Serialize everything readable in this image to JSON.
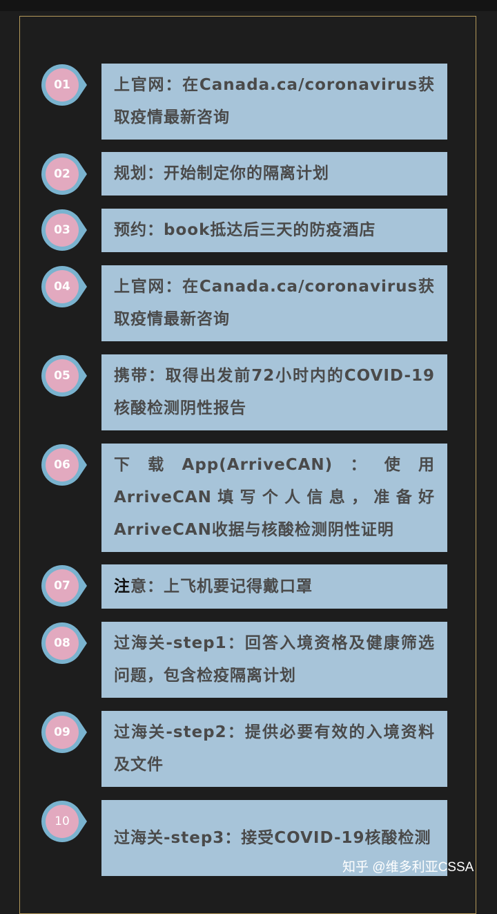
{
  "colors": {
    "background": "#1d1d1d",
    "frame_border": "#b59a5b",
    "box": "#a7c4d9",
    "badge_fill": "#e2a9bf",
    "badge_ring": "#7ab3cf",
    "text": "#4a4a4a"
  },
  "steps": [
    {
      "num": "01",
      "label": "上官网：",
      "text": "在Canada.ca/coronavirus获取疫情最新咨询"
    },
    {
      "num": "02",
      "label": "规划：",
      "text": "开始制定你的隔离计划"
    },
    {
      "num": "03",
      "label": "预约：",
      "text": "book抵达后三天的防疫酒店"
    },
    {
      "num": "04",
      "label": "上官网：",
      "text": "在Canada.ca/coronavirus获取疫情最新咨询"
    },
    {
      "num": "05",
      "label": "携带：",
      "text": "取得出发前72小时内的COVID-19核酸检测阴性报告"
    },
    {
      "num": "06",
      "label": "下载App(ArriveCAN)：",
      "text": "使用ArriveCAN填写个人信息，准备好ArriveCAN收据与核酸检测阴性证明"
    },
    {
      "num": "07",
      "label_dark": "注",
      "label": "意：",
      "text": "上飞机要记得戴口罩"
    },
    {
      "num": "08",
      "label": "过海关-step1：",
      "text": "回答入境资格及健康筛选问题，包含检疫隔离计划"
    },
    {
      "num": "09",
      "label": "过海关-step2：",
      "text": "提供必要有效的入境资料及文件"
    },
    {
      "num": "10",
      "label": "过海关-step3：",
      "text": "接受COVID-19核酸检测"
    }
  ],
  "watermark": "知乎 @维多利亚CSSA"
}
